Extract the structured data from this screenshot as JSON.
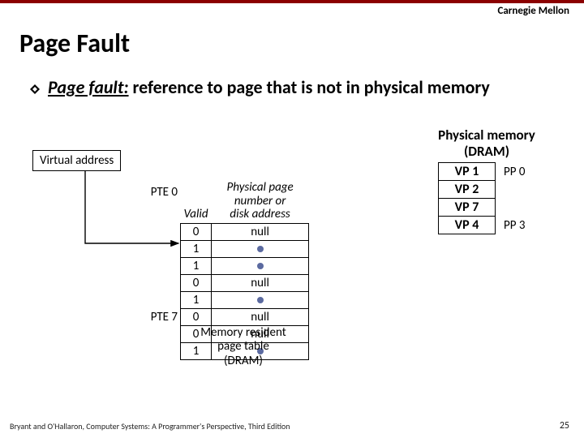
{
  "brand": "Carnegie Mellon",
  "title": "Page Fault",
  "bullet": {
    "term": "Page fault:",
    "rest": " reference to page that is not in physical memory"
  },
  "virtual_address_label": "Virtual address",
  "table_headers": {
    "valid": "Valid",
    "ppn": "Physical page\nnumber or\ndisk address"
  },
  "pte_labels": {
    "first": "PTE 0",
    "last": "PTE 7"
  },
  "pte_rows": [
    {
      "valid": "0",
      "addr": "null"
    },
    {
      "valid": "1",
      "addr": "•"
    },
    {
      "valid": "1",
      "addr": "•"
    },
    {
      "valid": "0",
      "addr": "null"
    },
    {
      "valid": "1",
      "addr": "•"
    },
    {
      "valid": "0",
      "addr": "null"
    },
    {
      "valid": "0",
      "addr": "null"
    },
    {
      "valid": "1",
      "addr": "•"
    }
  ],
  "page_table_caption": "Memory resident\npage table\n(DRAM)",
  "physical_memory_heading": "Physical memory\n(DRAM)",
  "pm_rows": [
    {
      "vp": "VP 1",
      "pp": "PP 0"
    },
    {
      "vp": "VP 2",
      "pp": ""
    },
    {
      "vp": "VP 7",
      "pp": ""
    },
    {
      "vp": "VP 4",
      "pp": "PP 3"
    }
  ],
  "footer": "Bryant and O'Hallaron, Computer Systems: A Programmer's Perspective, Third Edition",
  "page_number": "25"
}
